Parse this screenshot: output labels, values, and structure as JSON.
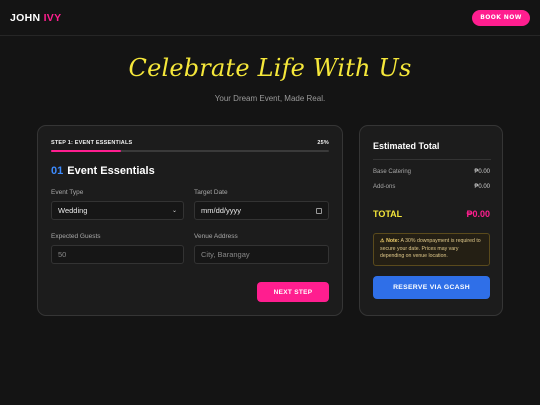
{
  "header": {
    "logo_main": "JOHN",
    "logo_accent": "IVY",
    "book_label": "BOOK NOW"
  },
  "hero": {
    "title": "Celebrate Life With Us",
    "subtitle": "Your Dream Event, Made Real."
  },
  "form": {
    "step_label": "STEP 1: EVENT ESSENTIALS",
    "progress_text": "25%",
    "progress_value": 0.25,
    "section_number": "01",
    "section_title": "Event Essentials",
    "fields": {
      "event_type_label": "Event Type",
      "event_type_value": "Wedding",
      "target_date_label": "Target Date",
      "target_date_placeholder": "mm/dd/yyyy",
      "guests_label": "Expected Guests",
      "guests_value": "50",
      "venue_label": "Venue Address",
      "venue_placeholder": "City, Barangay"
    },
    "next_label": "NEXT STEP"
  },
  "summary": {
    "title": "Estimated Total",
    "base_label": "Base Catering",
    "base_value": "₱0.00",
    "addons_label": "Add-ons",
    "addons_value": "₱0.00",
    "total_label": "TOTAL",
    "total_value": "₱0.00",
    "note_prefix": "⚠ Note:",
    "note_text": "A 30% downpayment is required to secure your date. Prices may vary depending on venue location.",
    "reserve_label": "RESERVE VIA GCASH"
  },
  "colors": {
    "accent_pink": "#ff1e8f",
    "accent_yellow": "#f5e73a",
    "accent_blue": "#2f6fe8",
    "background": "#141414"
  }
}
